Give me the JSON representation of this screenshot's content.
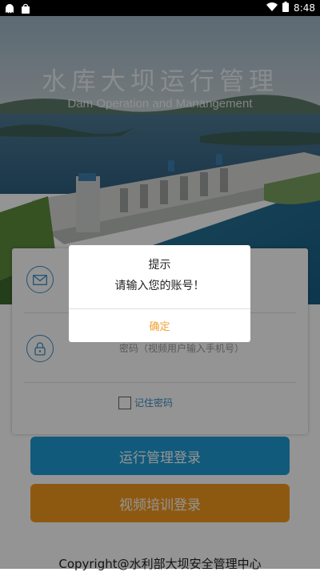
{
  "status_bar": {
    "time": "8:48"
  },
  "hero": {
    "title": "水库大坝运行管理",
    "subtitle": "Dam Operation and Manangement"
  },
  "form": {
    "account_placeholder": "",
    "password_placeholder": "密码（视频用户输入手机号）",
    "remember_label": "记住密码"
  },
  "buttons": {
    "operation_login": "运行管理登录",
    "video_login": "视频培训登录"
  },
  "footer": {
    "copyright": "Copyright@水利部大坝安全管理中心"
  },
  "dialog": {
    "title": "提示",
    "message": "请输入您的账号！",
    "confirm": "确定"
  },
  "colors": {
    "primary": "#1e9bd4",
    "secondary": "#f39a1e",
    "dialog_accent": "#f0a030"
  }
}
